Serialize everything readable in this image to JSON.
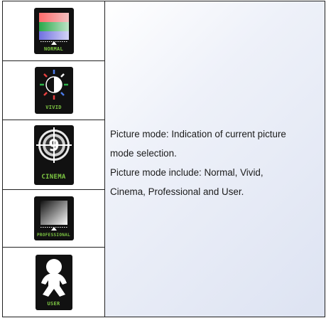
{
  "modes": [
    {
      "label": "NORMAL",
      "icon": "color-bars-icon"
    },
    {
      "label": "VIVID",
      "icon": "contrast-sun-icon"
    },
    {
      "label": "CINEMA",
      "icon": "film-reel-icon"
    },
    {
      "label": "PROFESSIONAL",
      "icon": "gradient-square-icon"
    },
    {
      "label": "USER",
      "icon": "person-icon"
    }
  ],
  "description": {
    "line1": "Picture mode: Indication of current picture",
    "line2": "mode selection.",
    "line3": "Picture mode include: Normal, Vivid,",
    "line4": "Cinema, Professional and User."
  },
  "colors": {
    "label_green": "#7ec843",
    "tile_bg": "#111111"
  }
}
